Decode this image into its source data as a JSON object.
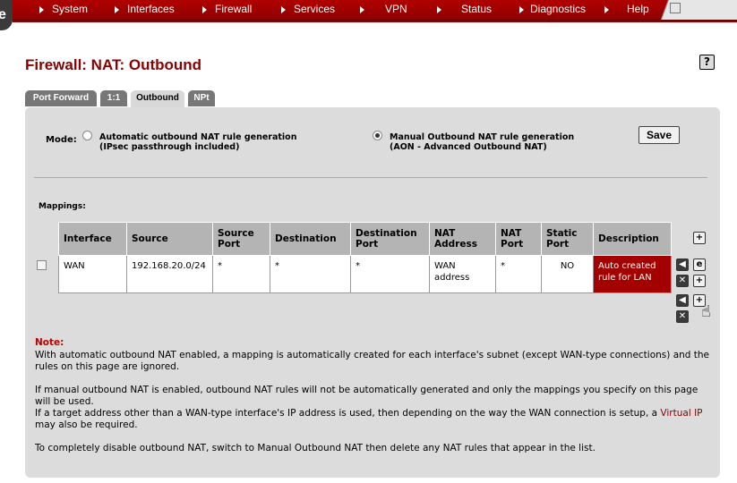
{
  "nav": {
    "items": [
      "System",
      "Interfaces",
      "Firewall",
      "Services",
      "VPN",
      "Status",
      "Diagnostics",
      "Help"
    ]
  },
  "page": {
    "title": "Firewall: NAT: Outbound",
    "help": "?"
  },
  "tabs": [
    "Port Forward",
    "1:1",
    "Outbound",
    "NPt"
  ],
  "mode": {
    "label": "Mode:",
    "options": [
      {
        "line1": "Automatic outbound NAT rule generation",
        "line2": "(IPsec passthrough included)",
        "checked": false
      },
      {
        "line1": "Manual Outbound NAT rule generation",
        "line2": "(AON - Advanced Outbound NAT)",
        "checked": true
      }
    ],
    "save_label": "Save"
  },
  "mappings": {
    "label": "Mappings:",
    "columns": [
      [
        "Interface"
      ],
      [
        "Source"
      ],
      [
        "Source",
        "Port"
      ],
      [
        "Destination"
      ],
      [
        "Destination",
        "Port"
      ],
      [
        "NAT",
        "Address"
      ],
      [
        "NAT",
        "Port"
      ],
      [
        "Static",
        "Port"
      ],
      [
        "Description"
      ]
    ],
    "rows": [
      {
        "interface": "WAN",
        "source": "192.168.20.0/24",
        "source_port": "*",
        "destination": "*",
        "destination_port": "*",
        "nat_address_l1": "WAN",
        "nat_address_l2": "address",
        "nat_port": "*",
        "static_port": "NO",
        "description_l1": "Auto created",
        "description_l2": "rule for LAN"
      }
    ]
  },
  "icons": {
    "add": "add-icon",
    "edit": "edit-icon",
    "move": "move-icon",
    "delete": "delete-icon",
    "cursor": "hand-cursor-icon"
  },
  "notes": {
    "title": "Note:",
    "p1": "With automatic outbound NAT enabled, a mapping is automatically created for each interface's subnet (except WAN-type connections) and the rules on this page are ignored.",
    "p2": "If manual outbound NAT is enabled, outbound NAT rules will not be automatically generated and only the mappings you specify on this page will be used.",
    "p3_a": "If a target address other than a WAN-type interface's IP address is used, then depending on the way the WAN connection is setup, a",
    "p3_link": "Virtual IP",
    "p3_b": "may also be required.",
    "p4": "To completely disable outbound NAT, switch to Manual Outbound NAT then delete any NAT rules that appear in the list."
  },
  "colors": {
    "nav_red": "#a00000",
    "title_red": "#8b0000",
    "desc_red": "#a30000",
    "note_red": "#c00000",
    "panel_gray": "#dcdcdc"
  }
}
